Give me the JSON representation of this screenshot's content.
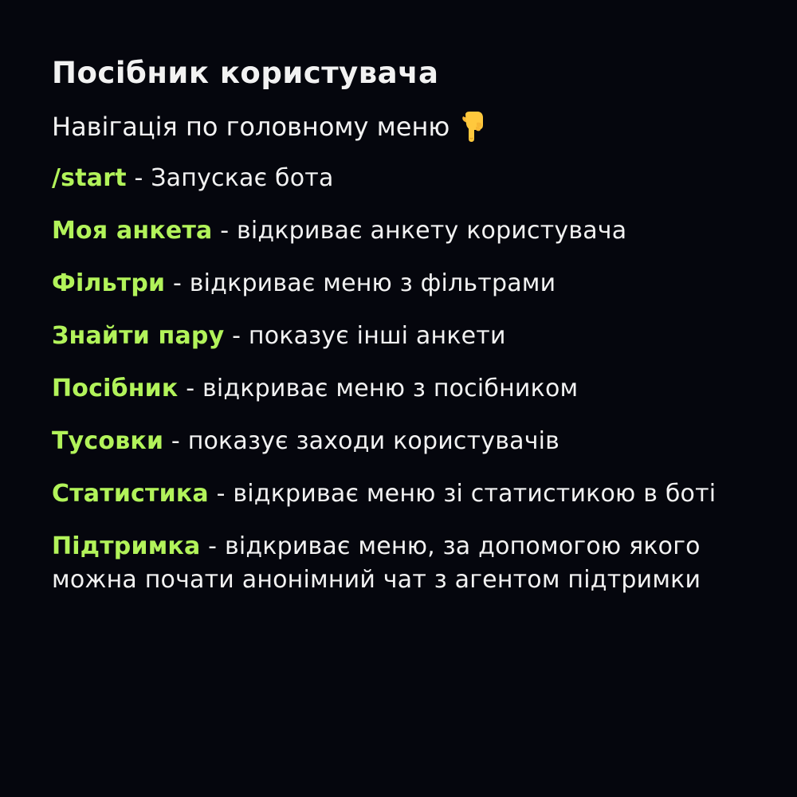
{
  "title": "Посібник користувача",
  "subtitle": "Навігація по головному меню",
  "subtitle_icon": "pointing-down-hand-icon",
  "accent_color": "#b2f35a",
  "background_color": "#05060d",
  "separator": " - ",
  "items": [
    {
      "command": "/start",
      "description": "Запускає бота"
    },
    {
      "command": "Моя анкета",
      "description": "відкриває анкету користувача"
    },
    {
      "command": "Фільтри",
      "description": "відкриває меню з фільтрами"
    },
    {
      "command": "Знайти пару",
      "description": "показує інші анкети"
    },
    {
      "command": "Посібник",
      "description": "відкриває меню з посібником"
    },
    {
      "command": "Тусовки",
      "description": "показує заходи користувачів"
    },
    {
      "command": "Статистика",
      "description": "відкриває меню зі статистикою в боті"
    },
    {
      "command": "Підтримка",
      "description": "відкриває меню, за допомогою якого можна почати анонімний чат з агентом підтримки"
    }
  ]
}
